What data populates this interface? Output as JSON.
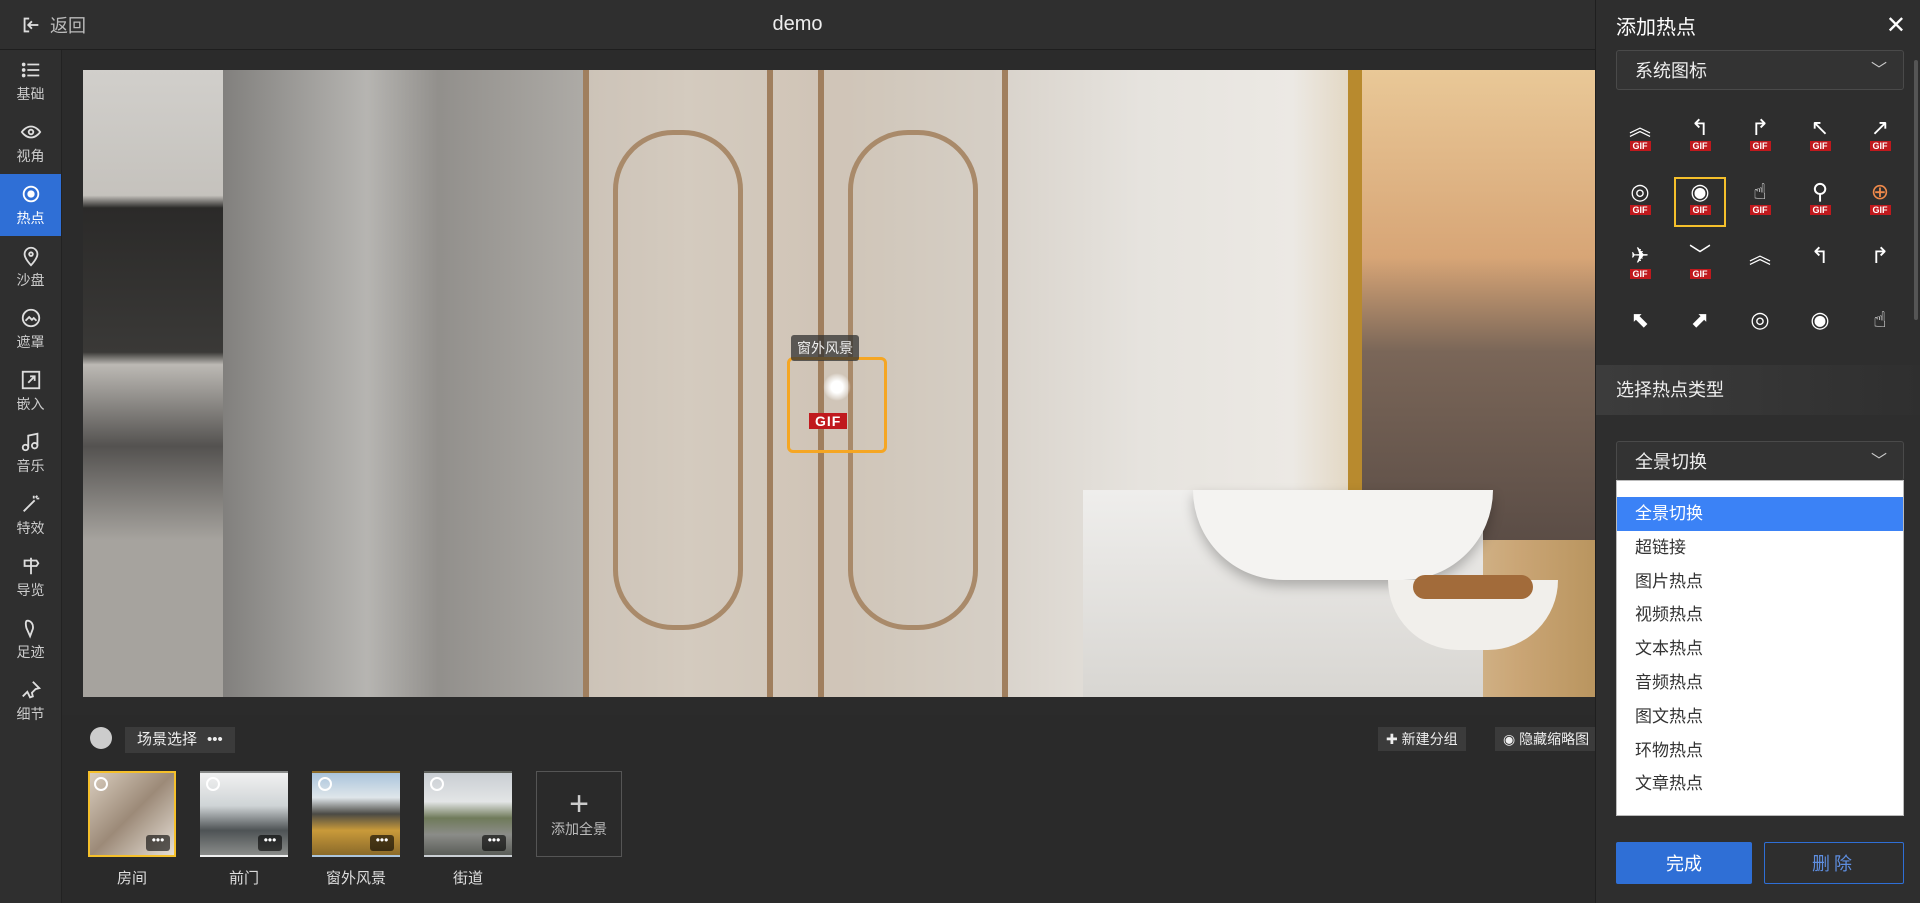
{
  "topbar": {
    "back_label": "返回",
    "title": "demo"
  },
  "rail": [
    {
      "label": "基础",
      "icon": "list-icon"
    },
    {
      "label": "视角",
      "icon": "eye-icon"
    },
    {
      "label": "热点",
      "icon": "target-icon",
      "active": true
    },
    {
      "label": "沙盘",
      "icon": "pin-icon"
    },
    {
      "label": "遮罩",
      "icon": "mask-icon"
    },
    {
      "label": "嵌入",
      "icon": "embed-icon"
    },
    {
      "label": "音乐",
      "icon": "music-icon"
    },
    {
      "label": "特效",
      "icon": "wand-icon"
    },
    {
      "label": "导览",
      "icon": "signpost-icon"
    },
    {
      "label": "足迹",
      "icon": "footprint-icon"
    },
    {
      "label": "细节",
      "icon": "pushpin-icon"
    }
  ],
  "hotspot": {
    "label": "窗外风景",
    "gif": "GIF"
  },
  "bottom": {
    "scene_tab": "场景选择",
    "new_group": "新建分组",
    "hide_thumbs": "隐藏缩略图",
    "add_pano": "添加全景",
    "scenes": [
      {
        "label": "房间",
        "selected": true
      },
      {
        "label": "前门"
      },
      {
        "label": "窗外风景"
      },
      {
        "label": "街道"
      }
    ]
  },
  "panel": {
    "title": "添加热点",
    "icon_select": "系统图标",
    "section_title": "选择热点类型",
    "type_select": "全景切换",
    "gif_badge": "GIF",
    "options": [
      "全景切换",
      "超链接",
      "图片热点",
      "视频热点",
      "文本热点",
      "音频热点",
      "图文热点",
      "环物热点",
      "文章热点"
    ],
    "done": "完成",
    "delete": "删除"
  },
  "colors": {
    "accent": "#2f6fd6",
    "selected": "#f5c02b",
    "hotspot_frame": "#f5a623",
    "gif_red": "#c0191d"
  }
}
